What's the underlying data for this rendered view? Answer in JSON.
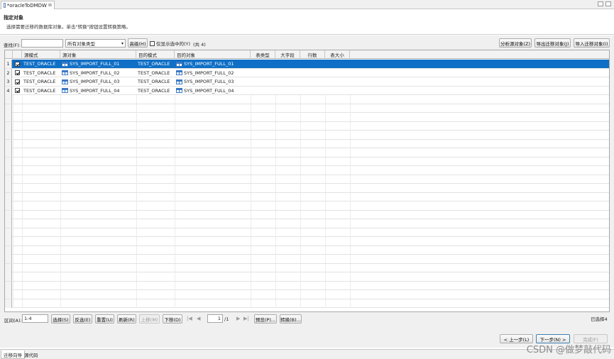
{
  "editor_tab": {
    "title": "*oracleToDMDW",
    "close": "⊠"
  },
  "header": {
    "title": "指定对象",
    "description": "选择需要迁移的数据库对象。单击\"转换\"按钮设置转换策略。"
  },
  "toolbar": {
    "find_label": "查找(F):",
    "find_value": "",
    "type_select": "所有对象类型",
    "advanced": "高级(H)",
    "only_selected": "仅显示选中的(Y)",
    "total": "(共 4)",
    "analyze_source": "分析源对象(Z)",
    "export_objects": "导出迁移对象(J)",
    "import_objects": "导入迁移对象(I)"
  },
  "table": {
    "columns": [
      "源模式",
      "源对象",
      "目的模式",
      "目的对象",
      "表类型",
      "大字段",
      "行数",
      "表大小"
    ],
    "rows": [
      {
        "num": "1",
        "checked": true,
        "src_schema": "TEST_ORACLE",
        "src_obj": "SYS_IMPORT_FULL_01",
        "dst_schema": "TEST_ORACLE",
        "dst_obj": "SYS_IMPORT_FULL_01"
      },
      {
        "num": "2",
        "checked": true,
        "src_schema": "TEST_ORACLE",
        "src_obj": "SYS_IMPORT_FULL_02",
        "dst_schema": "TEST_ORACLE",
        "dst_obj": "SYS_IMPORT_FULL_02"
      },
      {
        "num": "3",
        "checked": true,
        "src_schema": "TEST_ORACLE",
        "src_obj": "SYS_IMPORT_FULL_03",
        "dst_schema": "TEST_ORACLE",
        "dst_obj": "SYS_IMPORT_FULL_03"
      },
      {
        "num": "4",
        "checked": true,
        "src_schema": "TEST_ORACLE",
        "src_obj": "SYS_IMPORT_FULL_04",
        "dst_schema": "TEST_ORACLE",
        "dst_obj": "SYS_IMPORT_FULL_04"
      }
    ]
  },
  "bottom_bar": {
    "range_label": "区间(A):",
    "range_value": "1-4",
    "select": "选择(S)",
    "invert": "反选(E)",
    "reset": "重置(U)",
    "refresh": "刷新(R)",
    "move_up": "上移(M)",
    "move_down": "下移(D)",
    "page_value": "1",
    "page_total": "/1",
    "preview": "预览(P)...",
    "convert": "转换(B)...",
    "selected_count": "已选择4"
  },
  "wizard": {
    "back": "< 上一步(L)",
    "next": "下一步(N) >",
    "finish": "完成(F)"
  },
  "bottom_tabs": [
    "迁移向导",
    "源代码"
  ],
  "watermark": "CSDN @做梦敲代码",
  "colors": {
    "selection": "#0f6fc6",
    "icon_blue": "#3b78c4"
  }
}
